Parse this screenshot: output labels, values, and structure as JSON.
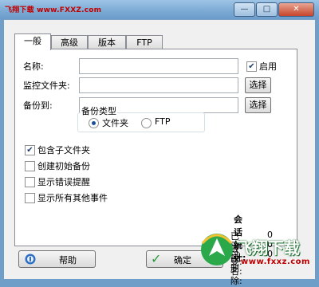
{
  "window": {
    "title_site": "飞翔下载 www.FXXZ.com",
    "controls": [
      "—",
      "□",
      "✕"
    ]
  },
  "tabs": [
    {
      "label": "一般",
      "active": true
    },
    {
      "label": "高级",
      "active": false
    },
    {
      "label": "版本",
      "active": false
    },
    {
      "label": "FTP",
      "active": false
    }
  ],
  "form": {
    "name_label": "名称:",
    "name_value": "",
    "enable_label": "启用",
    "enable_checked": true,
    "watch_label": "监控文件夹:",
    "watch_value": "",
    "watch_button": "选择",
    "backup_label": "备份到:",
    "backup_value": "",
    "backup_button": "选择",
    "backup_type_title": "备份类型",
    "backup_type_options": [
      {
        "label": "文件夹",
        "selected": true
      },
      {
        "label": "FTP",
        "selected": false
      }
    ]
  },
  "options": [
    {
      "label": "包含子文件夹",
      "checked": true
    },
    {
      "label": "创建初始备份",
      "checked": false
    },
    {
      "label": "显示错误提醒",
      "checked": false
    },
    {
      "label": "显示所有其他事件",
      "checked": false
    }
  ],
  "stats": {
    "title": "会话统计:",
    "rows": [
      {
        "label": "已改变:",
        "value": "0"
      },
      {
        "label": "已改名:",
        "value": "0"
      },
      {
        "label": "已删除:",
        "value": "0"
      }
    ]
  },
  "footer": {
    "help_label": "帮助",
    "ok_label": "确定"
  },
  "watermark": {
    "brand": "飞翔下载",
    "url": "www.fxxz.com"
  },
  "colors": {
    "title_gradient": "#7aa9d3",
    "window_bg": "#f0f0f0",
    "accent_blue": "#1b4f9c",
    "watermark_green": "#2aa84a",
    "watermark_red": "#c00000"
  }
}
